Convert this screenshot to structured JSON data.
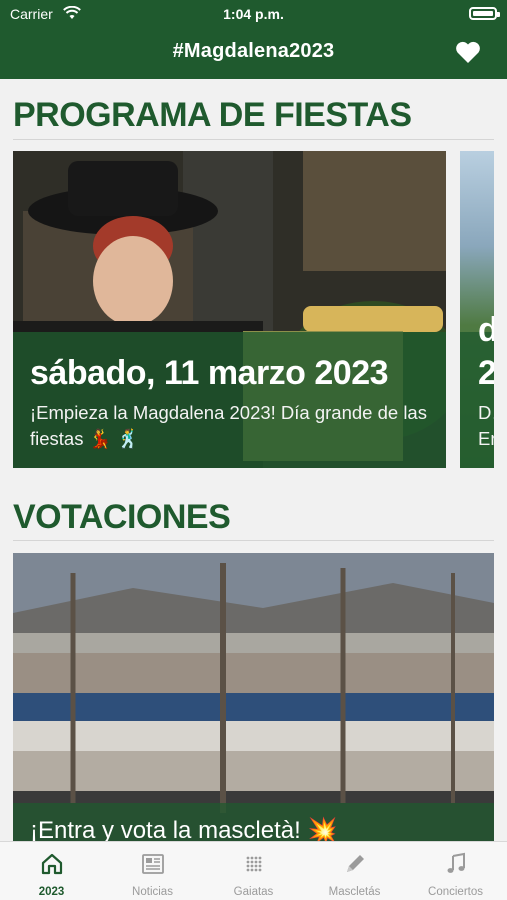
{
  "status_bar": {
    "carrier": "Carrier",
    "time": "1:04 p.m."
  },
  "nav": {
    "title": "#Magdalena2023",
    "favorite_icon": "heart-icon"
  },
  "fiestas": {
    "title": "PROGRAMA DE FIESTAS",
    "cards": [
      {
        "date": "sábado, 11 marzo 2023",
        "description": "¡Empieza la Magdalena 2023! Día grande de las fiestas 💃 🕺"
      },
      {
        "date": "d…",
        "date_line2": "2…",
        "description": "D… En…"
      }
    ]
  },
  "votaciones": {
    "title": "VOTACIONES",
    "card_text": "¡Entra y vota la mascletà! 💥"
  },
  "tabs": [
    {
      "label": "2023",
      "icon": "home-icon",
      "active": true
    },
    {
      "label": "Noticias",
      "icon": "newspaper-icon",
      "active": false
    },
    {
      "label": "Gaiatas",
      "icon": "grid-icon",
      "active": false
    },
    {
      "label": "Mascletás",
      "icon": "pencil-icon",
      "active": false
    },
    {
      "label": "Conciertos",
      "icon": "music-note-icon",
      "active": false
    }
  ],
  "colors": {
    "brand_green": "#1f5a2e",
    "background": "#f1f1f1",
    "tab_inactive": "#9b9b9b"
  }
}
